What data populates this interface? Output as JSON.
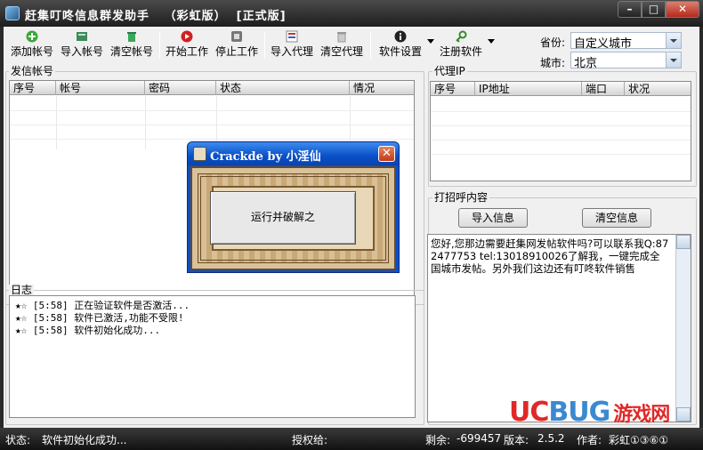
{
  "window": {
    "title": "赶集叮咚信息群发助手   （彩虹版）  [正式版]",
    "minimize_glyph": "–",
    "maximize_glyph": "□",
    "close_glyph": "✕"
  },
  "toolbar": {
    "items": [
      {
        "label": "添加帐号",
        "icon": "add-icon"
      },
      {
        "label": "导入帐号",
        "icon": "import-account-icon"
      },
      {
        "label": "清空帐号",
        "icon": "trash-icon"
      },
      {
        "label": "开始工作",
        "icon": "play-icon"
      },
      {
        "label": "停止工作",
        "icon": "stop-icon"
      },
      {
        "label": "导入代理",
        "icon": "import-proxy-icon"
      },
      {
        "label": "清空代理",
        "icon": "clear-proxy-icon"
      },
      {
        "label": "软件设置",
        "icon": "info-icon"
      },
      {
        "label": "注册软件",
        "icon": "key-icon"
      }
    ]
  },
  "location": {
    "province_label": "省份:",
    "province_value": "自定义城市",
    "city_label": "城市:",
    "city_value": "北京"
  },
  "accounts": {
    "title": "发信帐号",
    "columns": [
      "序号",
      "帐号",
      "密码",
      "状态",
      "情况"
    ]
  },
  "proxy": {
    "title": "代理IP",
    "columns": [
      "序号",
      "IP地址",
      "端口",
      "状况"
    ]
  },
  "log": {
    "title": "日志",
    "lines": [
      "★☆ [5:58] 正在验证软件是否激活...",
      "★☆ [5:58] 软件已激活,功能不受限!",
      "★☆ [5:58] 软件初始化成功..."
    ]
  },
  "greeting": {
    "title": "打招呼内容",
    "import_label": "导入信息",
    "clear_label": "清空信息",
    "text": "您好,您那边需要赶集网发帖软件吗?可以联系我Q:872477753 tel:13018910026了解我，一键完成全国城市发帖。另外我们这边还有叮咚软件销售"
  },
  "status": {
    "status_label": "状态:",
    "status_value": "软件初始化成功...",
    "auth_label": "授权给:",
    "remain_label": "剩余:",
    "remain_value": "-699457",
    "version_label": "版本:",
    "version_value": "2.5.2",
    "author_label": "作者:",
    "author_value": "彩虹①③⑥①"
  },
  "dialog": {
    "title": "Crackde by 小淫仙",
    "button_label": "运行并破解之"
  },
  "watermark": {
    "uc": "UC",
    "bug": "BUG",
    "cn": "游戏网"
  },
  "colors": {
    "dialog_title": "#0a50c8",
    "watermark_red": "#e02828",
    "watermark_blue": "#3a8ad0"
  }
}
